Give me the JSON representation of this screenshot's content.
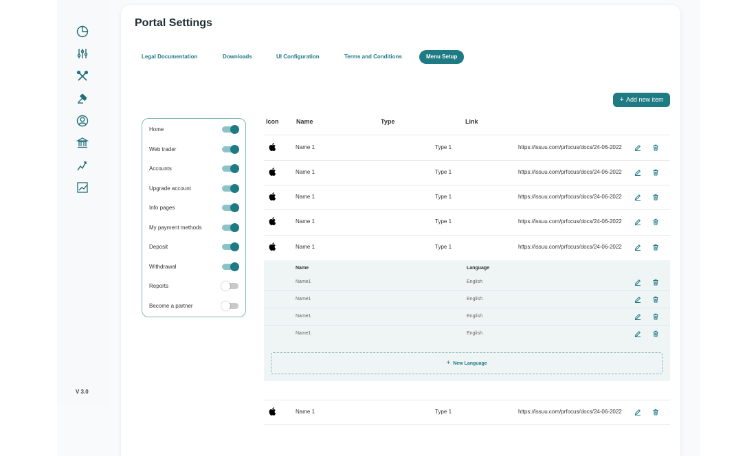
{
  "sidebar": {
    "icons": [
      "pie-chart-icon",
      "sliders-icon",
      "tools-icon",
      "gavel-icon",
      "user-circle-icon",
      "bank-icon",
      "trend-line-icon",
      "chart-area-icon"
    ],
    "version": "V 3.0"
  },
  "page": {
    "title": "Portal Settings"
  },
  "tabs": [
    {
      "label": "Legal Documentation",
      "active": false
    },
    {
      "label": "Downloads",
      "active": false
    },
    {
      "label": "UI Configuration",
      "active": false
    },
    {
      "label": "Terms and Conditions",
      "active": false
    },
    {
      "label": "Menu Setup",
      "active": true
    }
  ],
  "add_button": {
    "label": "Add new  item"
  },
  "menu_items": [
    {
      "label": "Home",
      "enabled": true
    },
    {
      "label": "Web trader",
      "enabled": true
    },
    {
      "label": "Accounts",
      "enabled": true
    },
    {
      "label": "Upgrade account",
      "enabled": true
    },
    {
      "label": "Info pages",
      "enabled": true
    },
    {
      "label": "My payment methods",
      "enabled": true
    },
    {
      "label": "Deposit",
      "enabled": true
    },
    {
      "label": "Withdrawal",
      "enabled": true
    },
    {
      "label": "Reports",
      "enabled": false
    },
    {
      "label": "Become a partner",
      "enabled": false
    }
  ],
  "table": {
    "headers": {
      "icon": "Icon",
      "name": "Name",
      "type": "Type",
      "link": "Link"
    },
    "rows": [
      {
        "icon": "apple-icon",
        "name": "Name 1",
        "type": "Type 1",
        "link": "https://issuu.com/prfocus/docs/24-06-2022"
      },
      {
        "icon": "apple-icon",
        "name": "Name 1",
        "type": "Type 1",
        "link": "https://issuu.com/prfocus/docs/24-06-2022"
      },
      {
        "icon": "apple-icon",
        "name": "Name 1",
        "type": "Type 1",
        "link": "https://issuu.com/prfocus/docs/24-06-2022"
      },
      {
        "icon": "apple-icon",
        "name": "Name 1",
        "type": "Type 1",
        "link": "https://issuu.com/prfocus/docs/24-06-2022"
      },
      {
        "icon": "apple-icon",
        "name": "Name 1",
        "type": "Type 1",
        "link": "https://issuu.com/prfocus/docs/24-06-2022"
      }
    ],
    "last_row": {
      "icon": "apple-icon",
      "name": "Name 1",
      "type": "Type 1",
      "link": "https://issuu.com/prfocus/docs/24-06-2022"
    }
  },
  "languages": {
    "headers": {
      "name": "Name",
      "language": "Language"
    },
    "rows": [
      {
        "name": "Name1",
        "language": "English"
      },
      {
        "name": "Name1",
        "language": "English"
      },
      {
        "name": "Name1",
        "language": "English"
      },
      {
        "name": "Name1",
        "language": "English"
      }
    ],
    "new_label": "New Language"
  },
  "colors": {
    "accent": "#1e7a83",
    "toggle_on_track": "#8cc3c8",
    "toggle_off_track": "#c9c9c9"
  }
}
